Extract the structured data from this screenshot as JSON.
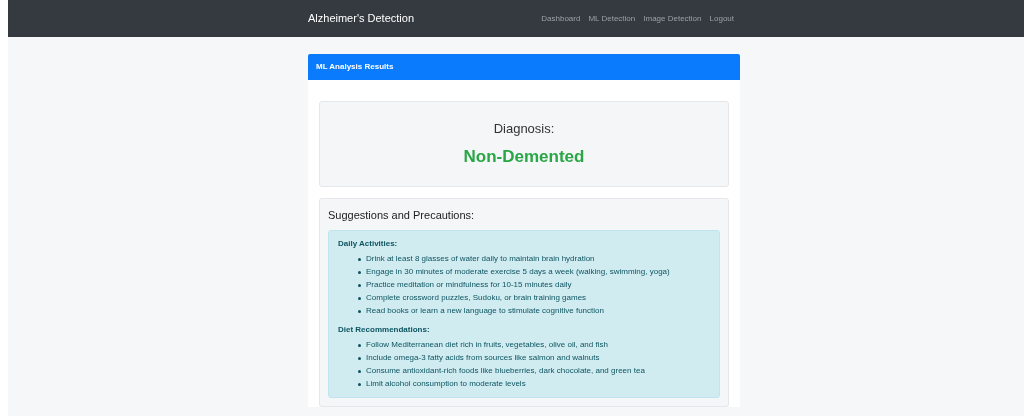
{
  "navbar": {
    "brand": "Alzheimer's Detection",
    "links": [
      {
        "label": "Dashboard"
      },
      {
        "label": "ML Detection"
      },
      {
        "label": "Image Detection"
      },
      {
        "label": "Logout"
      }
    ]
  },
  "card": {
    "header": "ML Analysis Results",
    "diagnosis": {
      "label": "Diagnosis:",
      "result": "Non-Demented"
    },
    "suggestions": {
      "title": "Suggestions and Precautions:",
      "sections": [
        {
          "heading": "Daily Activities:",
          "items": [
            "Drink at least 8 glasses of water daily to maintain brain hydration",
            "Engage in 30 minutes of moderate exercise 5 days a week (walking, swimming, yoga)",
            "Practice meditation or mindfulness for 10-15 minutes daily",
            "Complete crossword puzzles, Sudoku, or brain training games",
            "Read books or learn a new language to stimulate cognitive function"
          ]
        },
        {
          "heading": "Diet Recommendations:",
          "items": [
            "Follow Mediterranean diet rich in fruits, vegetables, olive oil, and fish",
            "Include omega-3 fatty acids from sources like salmon and walnuts",
            "Consume antioxidant-rich foods like blueberries, dark chocolate, and green tea",
            "Limit alcohol consumption to moderate levels"
          ]
        }
      ]
    }
  }
}
